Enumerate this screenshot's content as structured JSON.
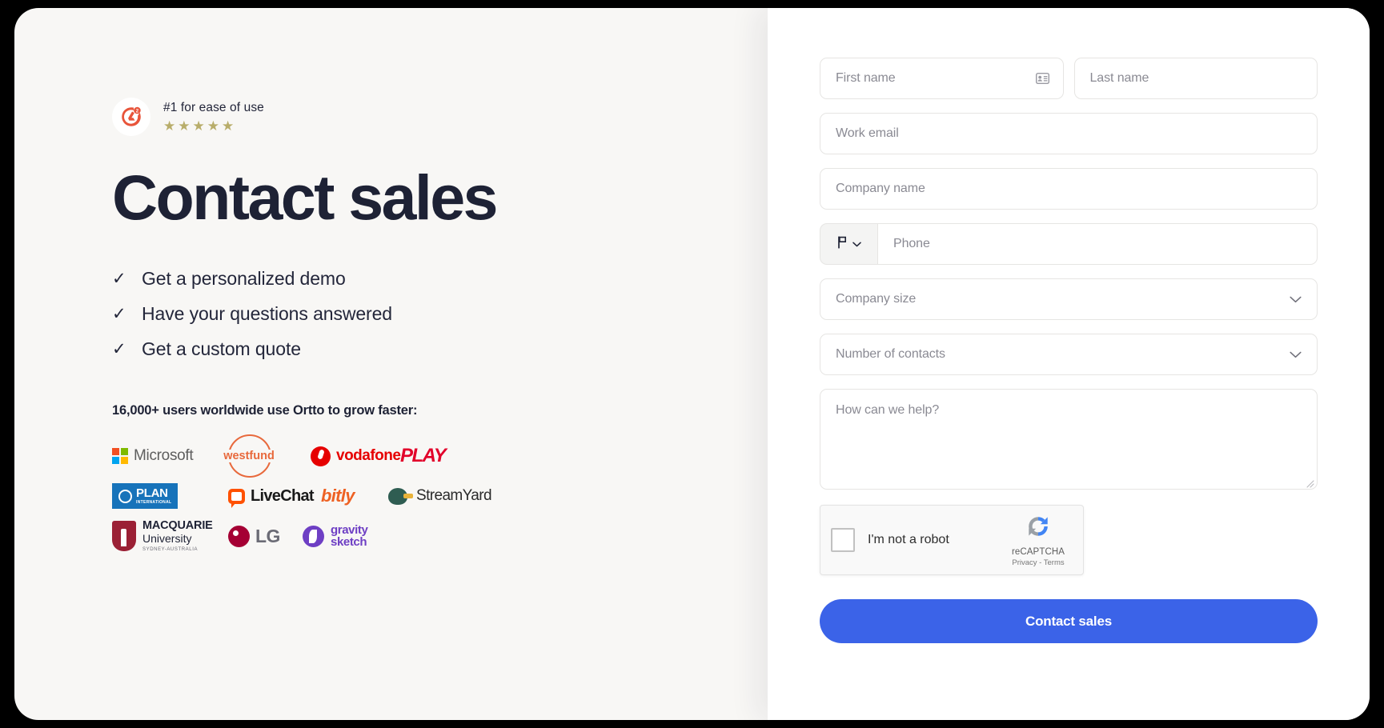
{
  "hero": {
    "g2": {
      "badge_icon": "g2-logo-icon",
      "label": "#1 for ease of use",
      "stars": [
        "★",
        "★",
        "★",
        "★",
        "★"
      ],
      "star_color": "#B8AD6A",
      "logo_color": "#E8543A"
    },
    "headline": "Contact sales",
    "benefits": [
      {
        "check": "✓",
        "text": "Get a personalized demo"
      },
      {
        "check": "✓",
        "text": "Have your questions answered"
      },
      {
        "check": "✓",
        "text": "Get a custom quote"
      }
    ],
    "proof_text": "16,000+ users worldwide use Ortto to grow faster:",
    "logo_rows": [
      [
        {
          "name": "Microsoft",
          "label": "Microsoft"
        },
        {
          "name": "westfund",
          "label": "westfund"
        },
        {
          "name": "vodafone",
          "label": "vodafone"
        },
        {
          "name": "PLAY",
          "label": "PLAY"
        }
      ],
      [
        {
          "name": "plan-international",
          "label": "PLAN",
          "sub": "INTERNATIONAL"
        },
        {
          "name": "livechat",
          "label": "LiveChat"
        },
        {
          "name": "bitly",
          "label": "bitly"
        },
        {
          "name": "streamyard",
          "label": "StreamYard"
        }
      ],
      [
        {
          "name": "macquarie-university",
          "label": "MACQUARIE",
          "sub": "University",
          "sub2": "SYDNEY-AUSTRALIA"
        },
        {
          "name": "lg",
          "label": "LG"
        },
        {
          "name": "gravity-sketch",
          "label": "gravity",
          "sub": "sketch"
        }
      ]
    ]
  },
  "form": {
    "first_name": {
      "placeholder": "First name",
      "value": ""
    },
    "last_name": {
      "placeholder": "Last name",
      "value": ""
    },
    "work_email": {
      "placeholder": "Work email",
      "value": ""
    },
    "company_name": {
      "placeholder": "Company name",
      "value": ""
    },
    "phone": {
      "placeholder": "Phone",
      "value": "",
      "country_icon": "flag-icon"
    },
    "company_size": {
      "placeholder": "Company size",
      "value": ""
    },
    "number_of_contacts": {
      "placeholder": "Number of contacts",
      "value": ""
    },
    "message": {
      "placeholder": "How can we help?",
      "value": ""
    },
    "recaptcha": {
      "label": "I'm not a robot",
      "brand": "reCAPTCHA",
      "links": "Privacy - Terms"
    },
    "submit_label": "Contact sales",
    "submit_color": "#3B63E8"
  }
}
